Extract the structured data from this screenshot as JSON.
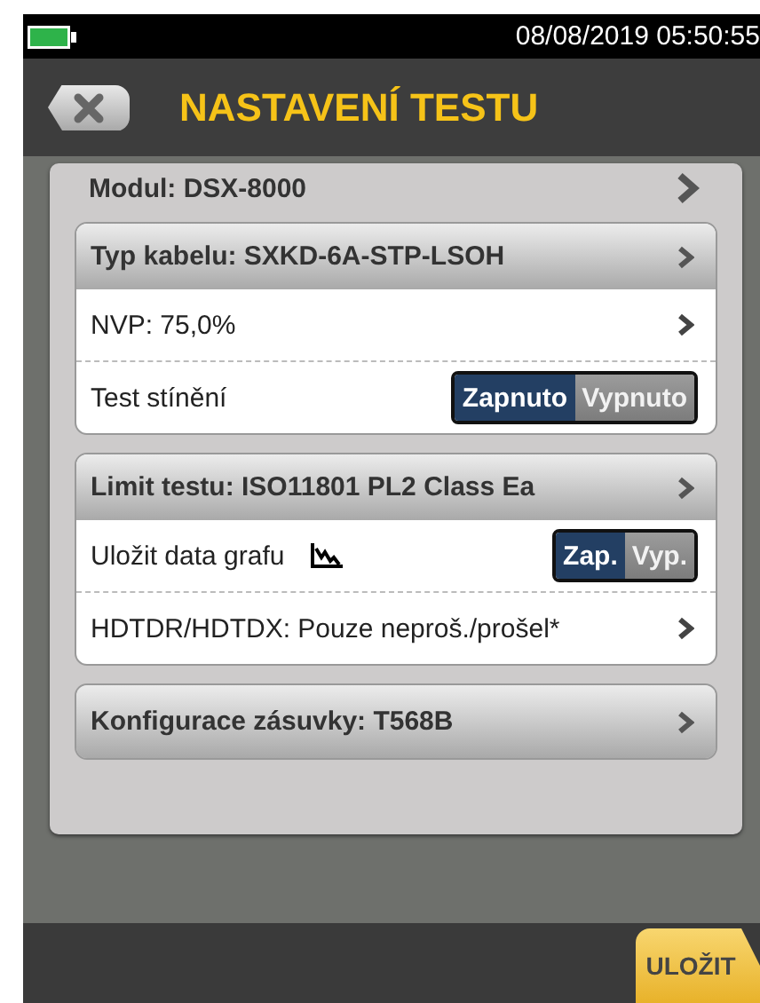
{
  "status_bar": {
    "datetime": "08/08/2019 05:50:55"
  },
  "header": {
    "title": "NASTAVENÍ TESTU"
  },
  "module": {
    "label": "Modul: DSX-8000"
  },
  "groups": [
    {
      "header": "Typ kabelu: SXKD-6A-STP-LSOH",
      "rows": [
        {
          "kind": "link",
          "label": "NVP: 75,0%"
        },
        {
          "kind": "toggle",
          "label": "Test stínění",
          "on_label": "Zapnuto",
          "off_label": "Vypnuto",
          "on": true
        }
      ]
    },
    {
      "header": "Limit testu: ISO11801 PL2 Class Ea",
      "rows": [
        {
          "kind": "graph_toggle",
          "label": "Uložit data grafu",
          "on_label": "Zap.",
          "off_label": "Vyp.",
          "on": true
        },
        {
          "kind": "link",
          "label": "HDTDR/HDTDX: Pouze neproš./prošel*"
        }
      ]
    },
    {
      "header": "Konfigurace zásuvky: T568B"
    }
  ],
  "footer": {
    "save_button": "ULOŽIT"
  }
}
